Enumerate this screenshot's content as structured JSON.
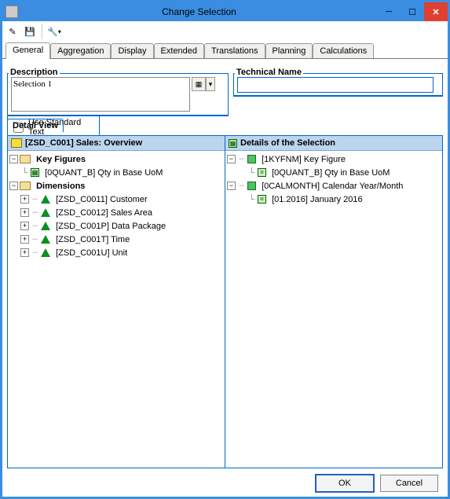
{
  "window": {
    "title": "Change Selection"
  },
  "tabs": [
    "General",
    "Aggregation",
    "Display",
    "Extended",
    "Translations",
    "Planning",
    "Calculations"
  ],
  "labels": {
    "description": "Description",
    "technical_name": "Technical Name",
    "use_std_text": "Use Standard Text",
    "detail_view": "Detail View"
  },
  "description_value": "Selection 1",
  "techname_value": "",
  "left_tree": {
    "header": "[ZSD_C001] Sales: Overview",
    "kf_label": "Key Figures",
    "kf_item": "[0QUANT_B] Qty in Base UoM",
    "dim_label": "Dimensions",
    "dims": [
      "[ZSD_C0011] Customer",
      "[ZSD_C0012] Sales Area",
      "[ZSD_C001P] Data Package",
      "[ZSD_C001T] Time",
      "[ZSD_C001U] Unit"
    ]
  },
  "right_tree": {
    "header": "Details of the Selection",
    "kf_node": "[1KYFNM] Key Figure",
    "kf_item": "[0QUANT_B] Qty in Base UoM",
    "char_node": "[0CALMONTH] Calendar Year/Month",
    "char_item": "[01.2016] January 2016"
  },
  "buttons": {
    "ok": "OK",
    "cancel": "Cancel"
  }
}
